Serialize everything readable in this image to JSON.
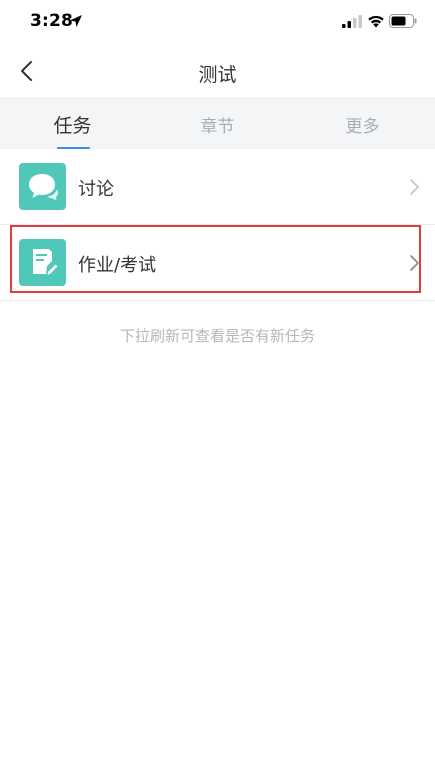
{
  "status_bar": {
    "time": "3:28"
  },
  "nav": {
    "title": "测试"
  },
  "tabs": [
    {
      "label": "任务",
      "active": true
    },
    {
      "label": "章节",
      "active": false
    },
    {
      "label": "更多",
      "active": false
    }
  ],
  "list": [
    {
      "label": "讨论",
      "icon": "discussion-icon",
      "highlighted": false
    },
    {
      "label": "作业/考试",
      "icon": "homework-icon",
      "highlighted": true
    }
  ],
  "hint": "下拉刷新可查看是否有新任务",
  "colors": {
    "accent": "#3a8ee6",
    "icon_bg": "#4fc7b9",
    "highlight": "#e23b3b"
  }
}
